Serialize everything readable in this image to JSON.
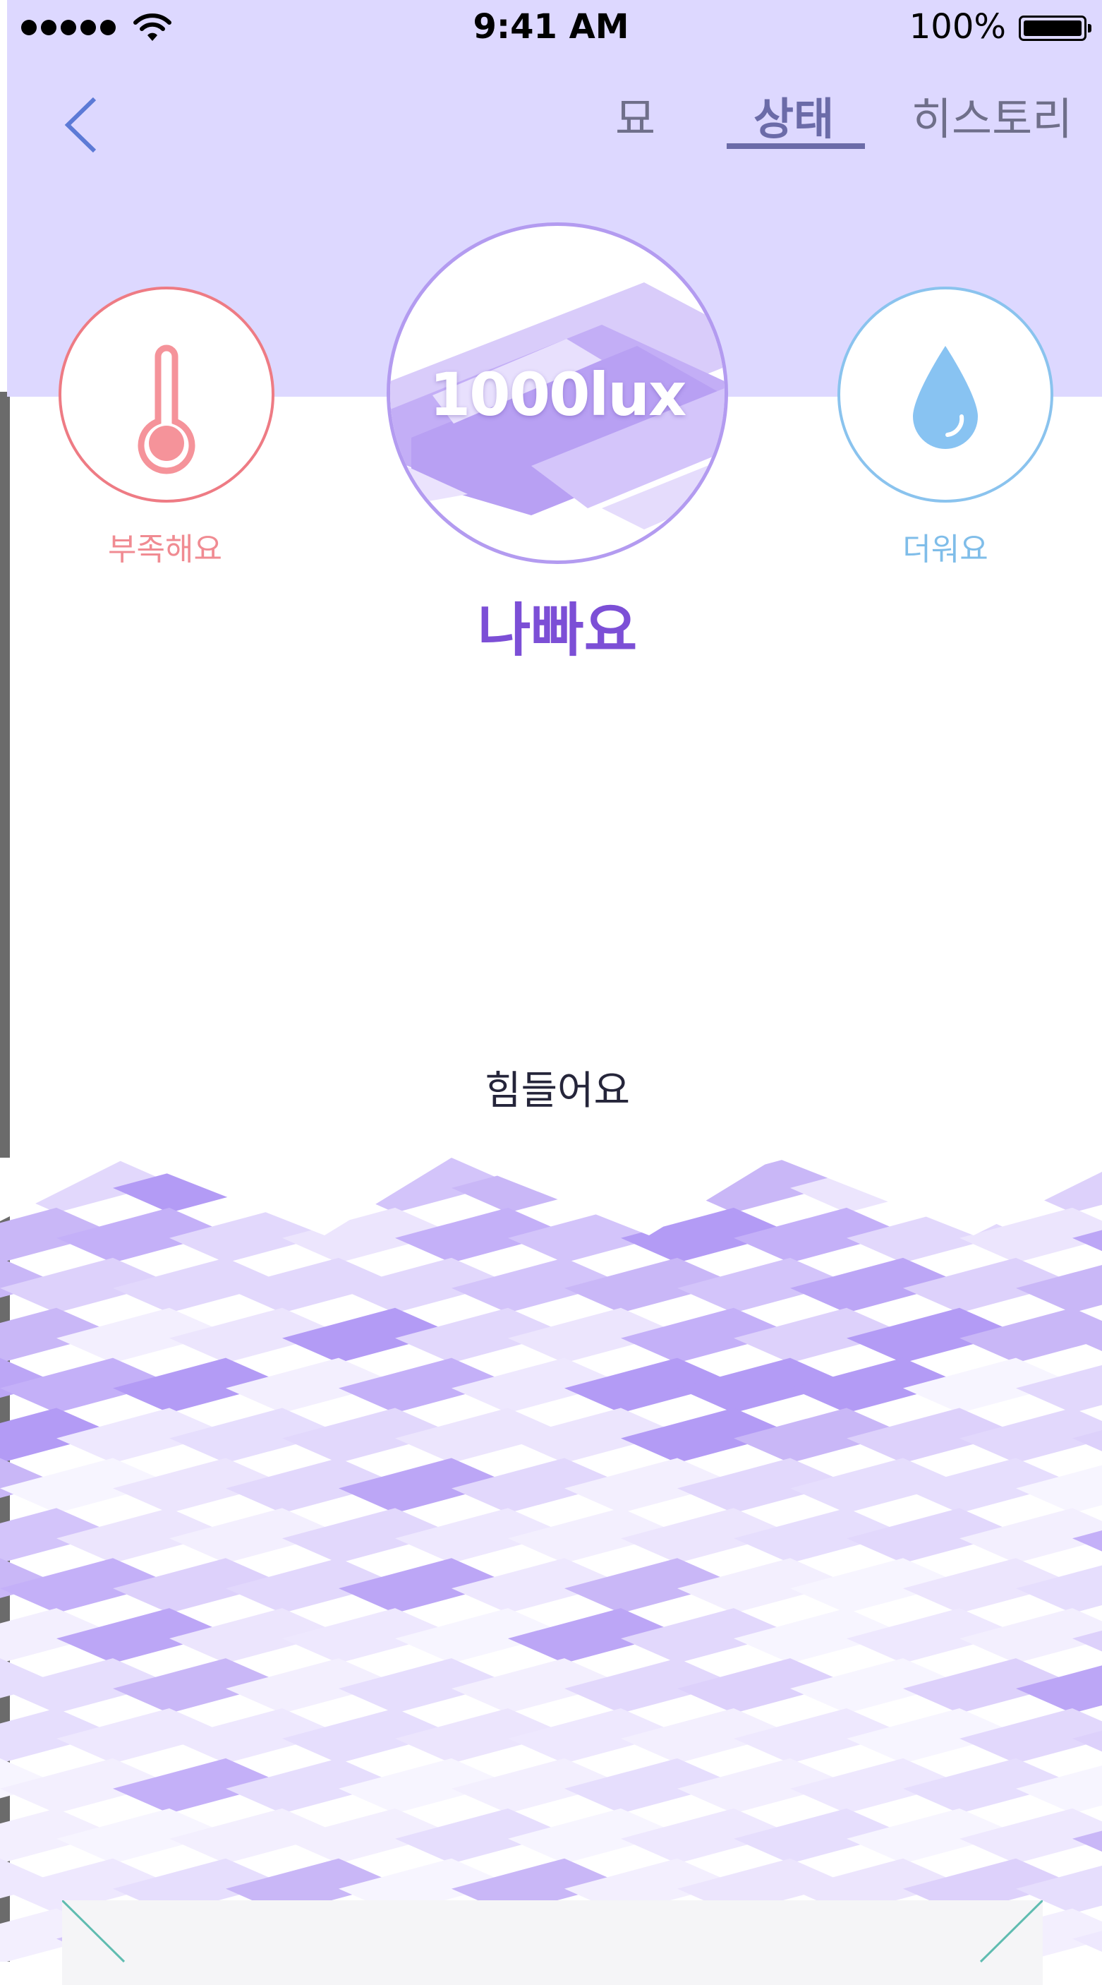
{
  "status_bar": {
    "time": "9:41 AM",
    "battery": "100%"
  },
  "tabs": [
    {
      "label": "묘"
    },
    {
      "label": "상태",
      "selected": true
    },
    {
      "label": "히스토리"
    }
  ],
  "gauges": {
    "temperature": {
      "status": "부족해요",
      "icon": "thermometer-icon",
      "color": "#ee7b84"
    },
    "light": {
      "value": "1000lux",
      "status": "나빠요",
      "color": "#b39bf0"
    },
    "water": {
      "status": "더워요",
      "icon": "water-drop-icon",
      "color": "#8ac3ee"
    }
  },
  "message": "힘들어요",
  "colors": {
    "header_bg": "#ddd8ff",
    "accent": "#7c4fd6",
    "nav": "#6b6ba8"
  }
}
